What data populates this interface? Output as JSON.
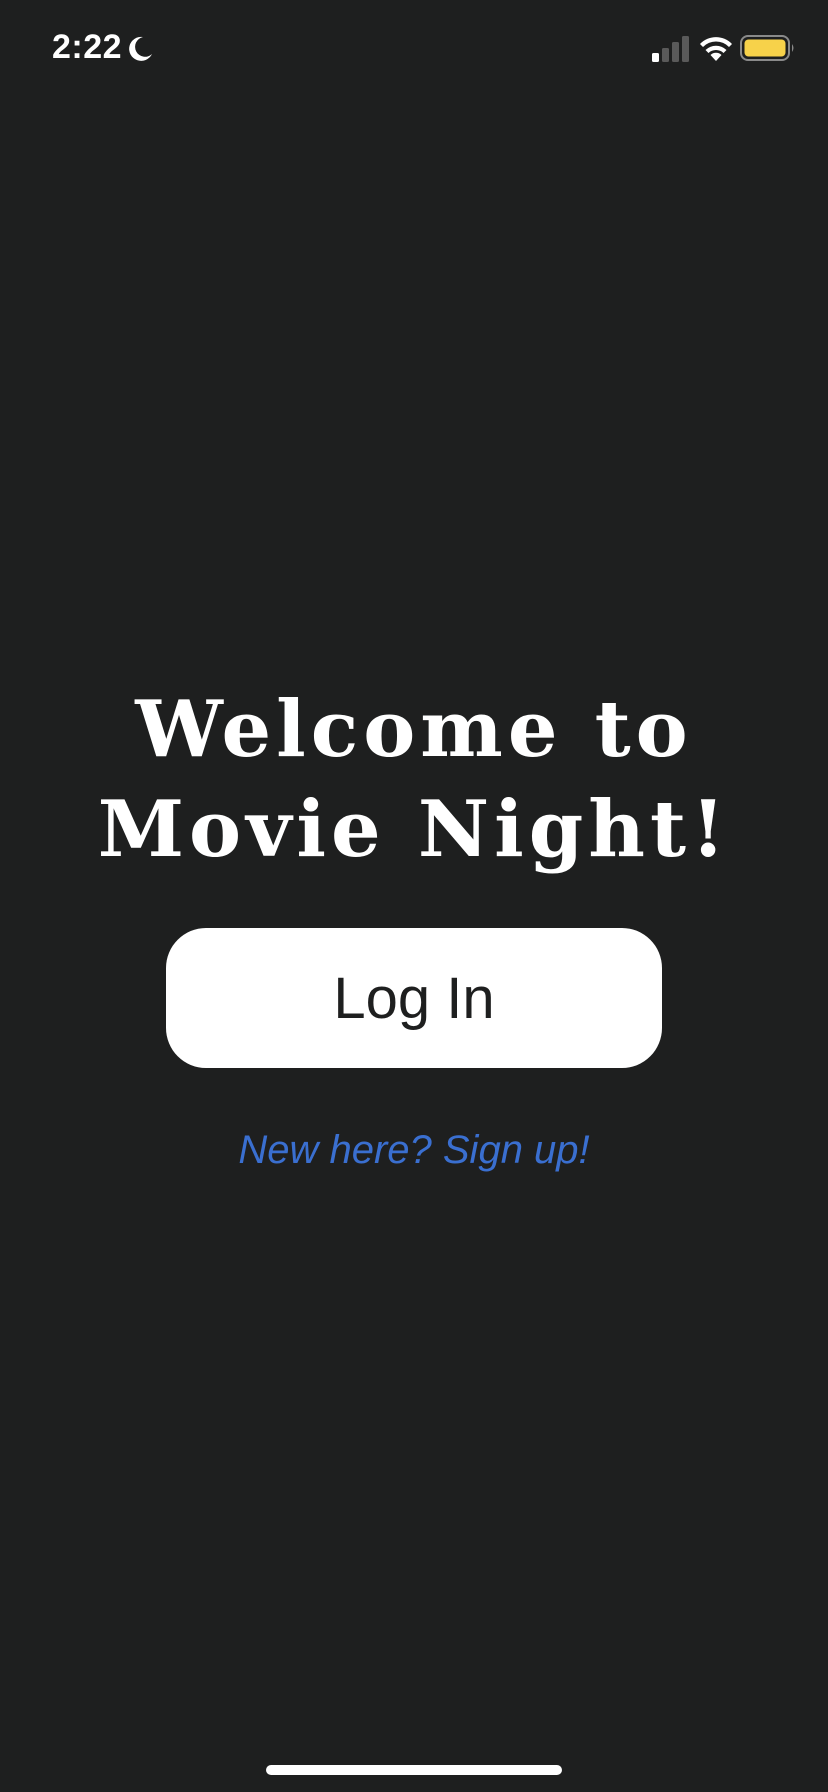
{
  "status_bar": {
    "time": "2:22",
    "icons": [
      "moon-icon",
      "cellular-signal-icon",
      "wifi-icon",
      "battery-icon"
    ],
    "battery_color": "#f7d24a"
  },
  "welcome": {
    "title_line1": "Welcome to",
    "title_line2": "Movie Night!"
  },
  "actions": {
    "login_label": "Log In",
    "signup_label": "New here? Sign up!"
  },
  "colors": {
    "background": "#1e1f1f",
    "button_background": "#ffffff",
    "link": "#3a6fd0"
  }
}
